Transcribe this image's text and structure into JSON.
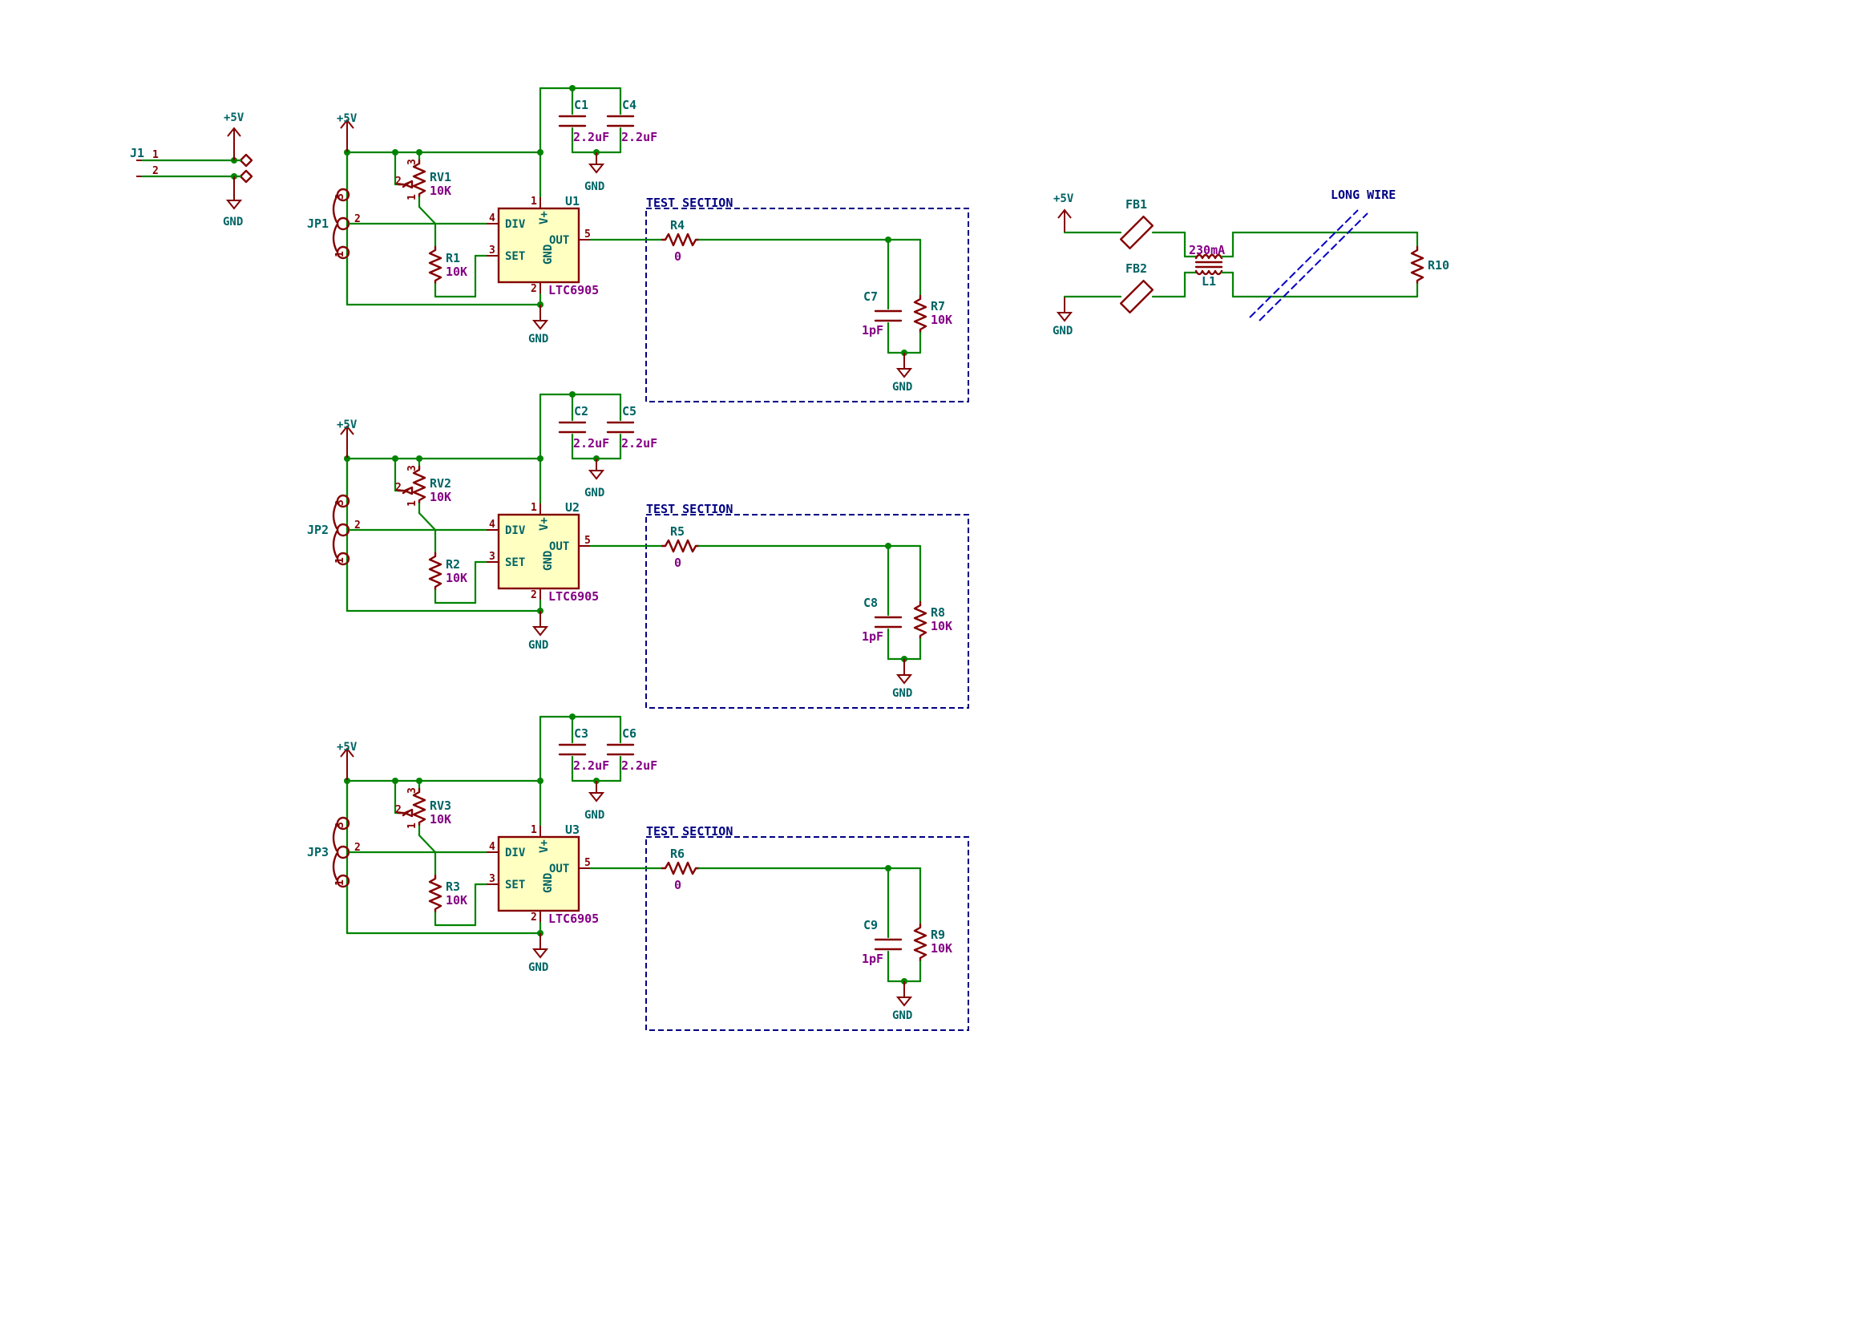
{
  "power": {
    "vcc": "+5V",
    "gnd": "GND"
  },
  "connector": {
    "ref": "J1",
    "pin1": "1",
    "pin2": "2"
  },
  "ic_pins": {
    "div": "DIV",
    "set": "SET",
    "out": "OUT",
    "vplus": "V+",
    "gnd": "GND",
    "n_vplus": "1",
    "n_gnd": "2",
    "n_set": "3",
    "n_div": "4",
    "n_out": "5"
  },
  "pot_pins": {
    "p1": "1",
    "p2": "2",
    "p3": "3"
  },
  "channels": [
    {
      "jp": "JP1",
      "rv": "RV1",
      "rv_val": "10K",
      "r_set": "R1",
      "r_set_val": "10K",
      "ca": "C1",
      "ca_val": "2.2uF",
      "cb": "C4",
      "cb_val": "2.2uF",
      "u": "U1",
      "u_val": "LTC6905",
      "section": "TEST SECTION",
      "r_ser": "R4",
      "r_ser_val": "0",
      "c_load": "C7",
      "c_load_val": "1pF",
      "r_load": "R7",
      "r_load_val": "10K"
    },
    {
      "jp": "JP2",
      "rv": "RV2",
      "rv_val": "10K",
      "r_set": "R2",
      "r_set_val": "10K",
      "ca": "C2",
      "ca_val": "2.2uF",
      "cb": "C5",
      "cb_val": "2.2uF",
      "u": "U2",
      "u_val": "LTC6905",
      "section": "TEST SECTION",
      "r_ser": "R5",
      "r_ser_val": "0",
      "c_load": "C8",
      "c_load_val": "1pF",
      "r_load": "R8",
      "r_load_val": "10K"
    },
    {
      "jp": "JP3",
      "rv": "RV3",
      "rv_val": "10K",
      "r_set": "R3",
      "r_set_val": "10K",
      "ca": "C3",
      "ca_val": "2.2uF",
      "cb": "C6",
      "cb_val": "2.2uF",
      "u": "U3",
      "u_val": "LTC6905",
      "section": "TEST SECTION",
      "r_ser": "R6",
      "r_ser_val": "0",
      "c_load": "C9",
      "c_load_val": "1pF",
      "r_load": "R9",
      "r_load_val": "10K"
    }
  ],
  "filter": {
    "fb1": "FB1",
    "fb2": "FB2",
    "choke_val": "230mA",
    "choke": "L1",
    "r_term": "R10",
    "note": "LONG WIRE"
  }
}
